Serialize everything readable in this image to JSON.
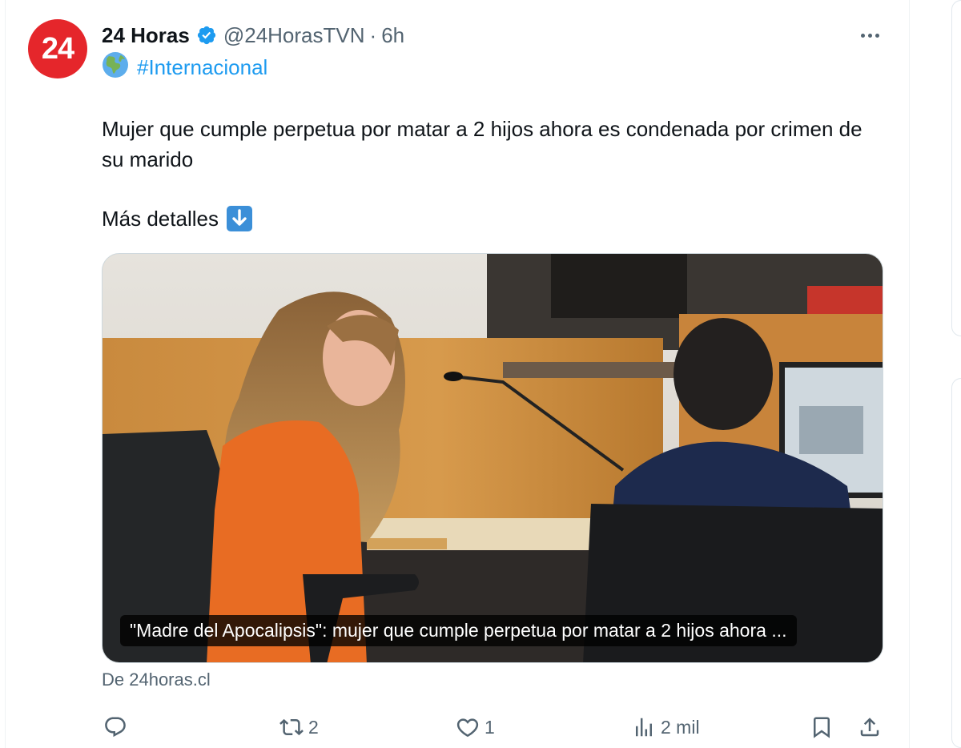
{
  "tweet": {
    "avatar_text": "24",
    "display_name": "24 Horas",
    "handle": "@24HorasTVN",
    "separator": "·",
    "time": "6h",
    "hashtag": "#Internacional",
    "text_line": "Mujer que cumple perpetua por matar a 2 hijos ahora es condenada por crimen de su marido",
    "more_details": "Más detalles",
    "icons": {
      "verified": "verified-badge-icon",
      "globe": "globe-emoji-icon",
      "down_arrow": "down-arrow-emoji-icon",
      "more": "more-icon"
    }
  },
  "card": {
    "title": "\"Madre del Apocalipsis\": mujer que cumple perpetua por matar a 2 hijos ahora ...",
    "source": "De 24horas.cl"
  },
  "actions": {
    "reply_count": "",
    "retweet_count": "2",
    "like_count": "1",
    "views_count": "2 mil"
  },
  "colors": {
    "accent": "#1d9bf0",
    "secondary_text": "#536471",
    "avatar_bg": "#e5262b"
  }
}
